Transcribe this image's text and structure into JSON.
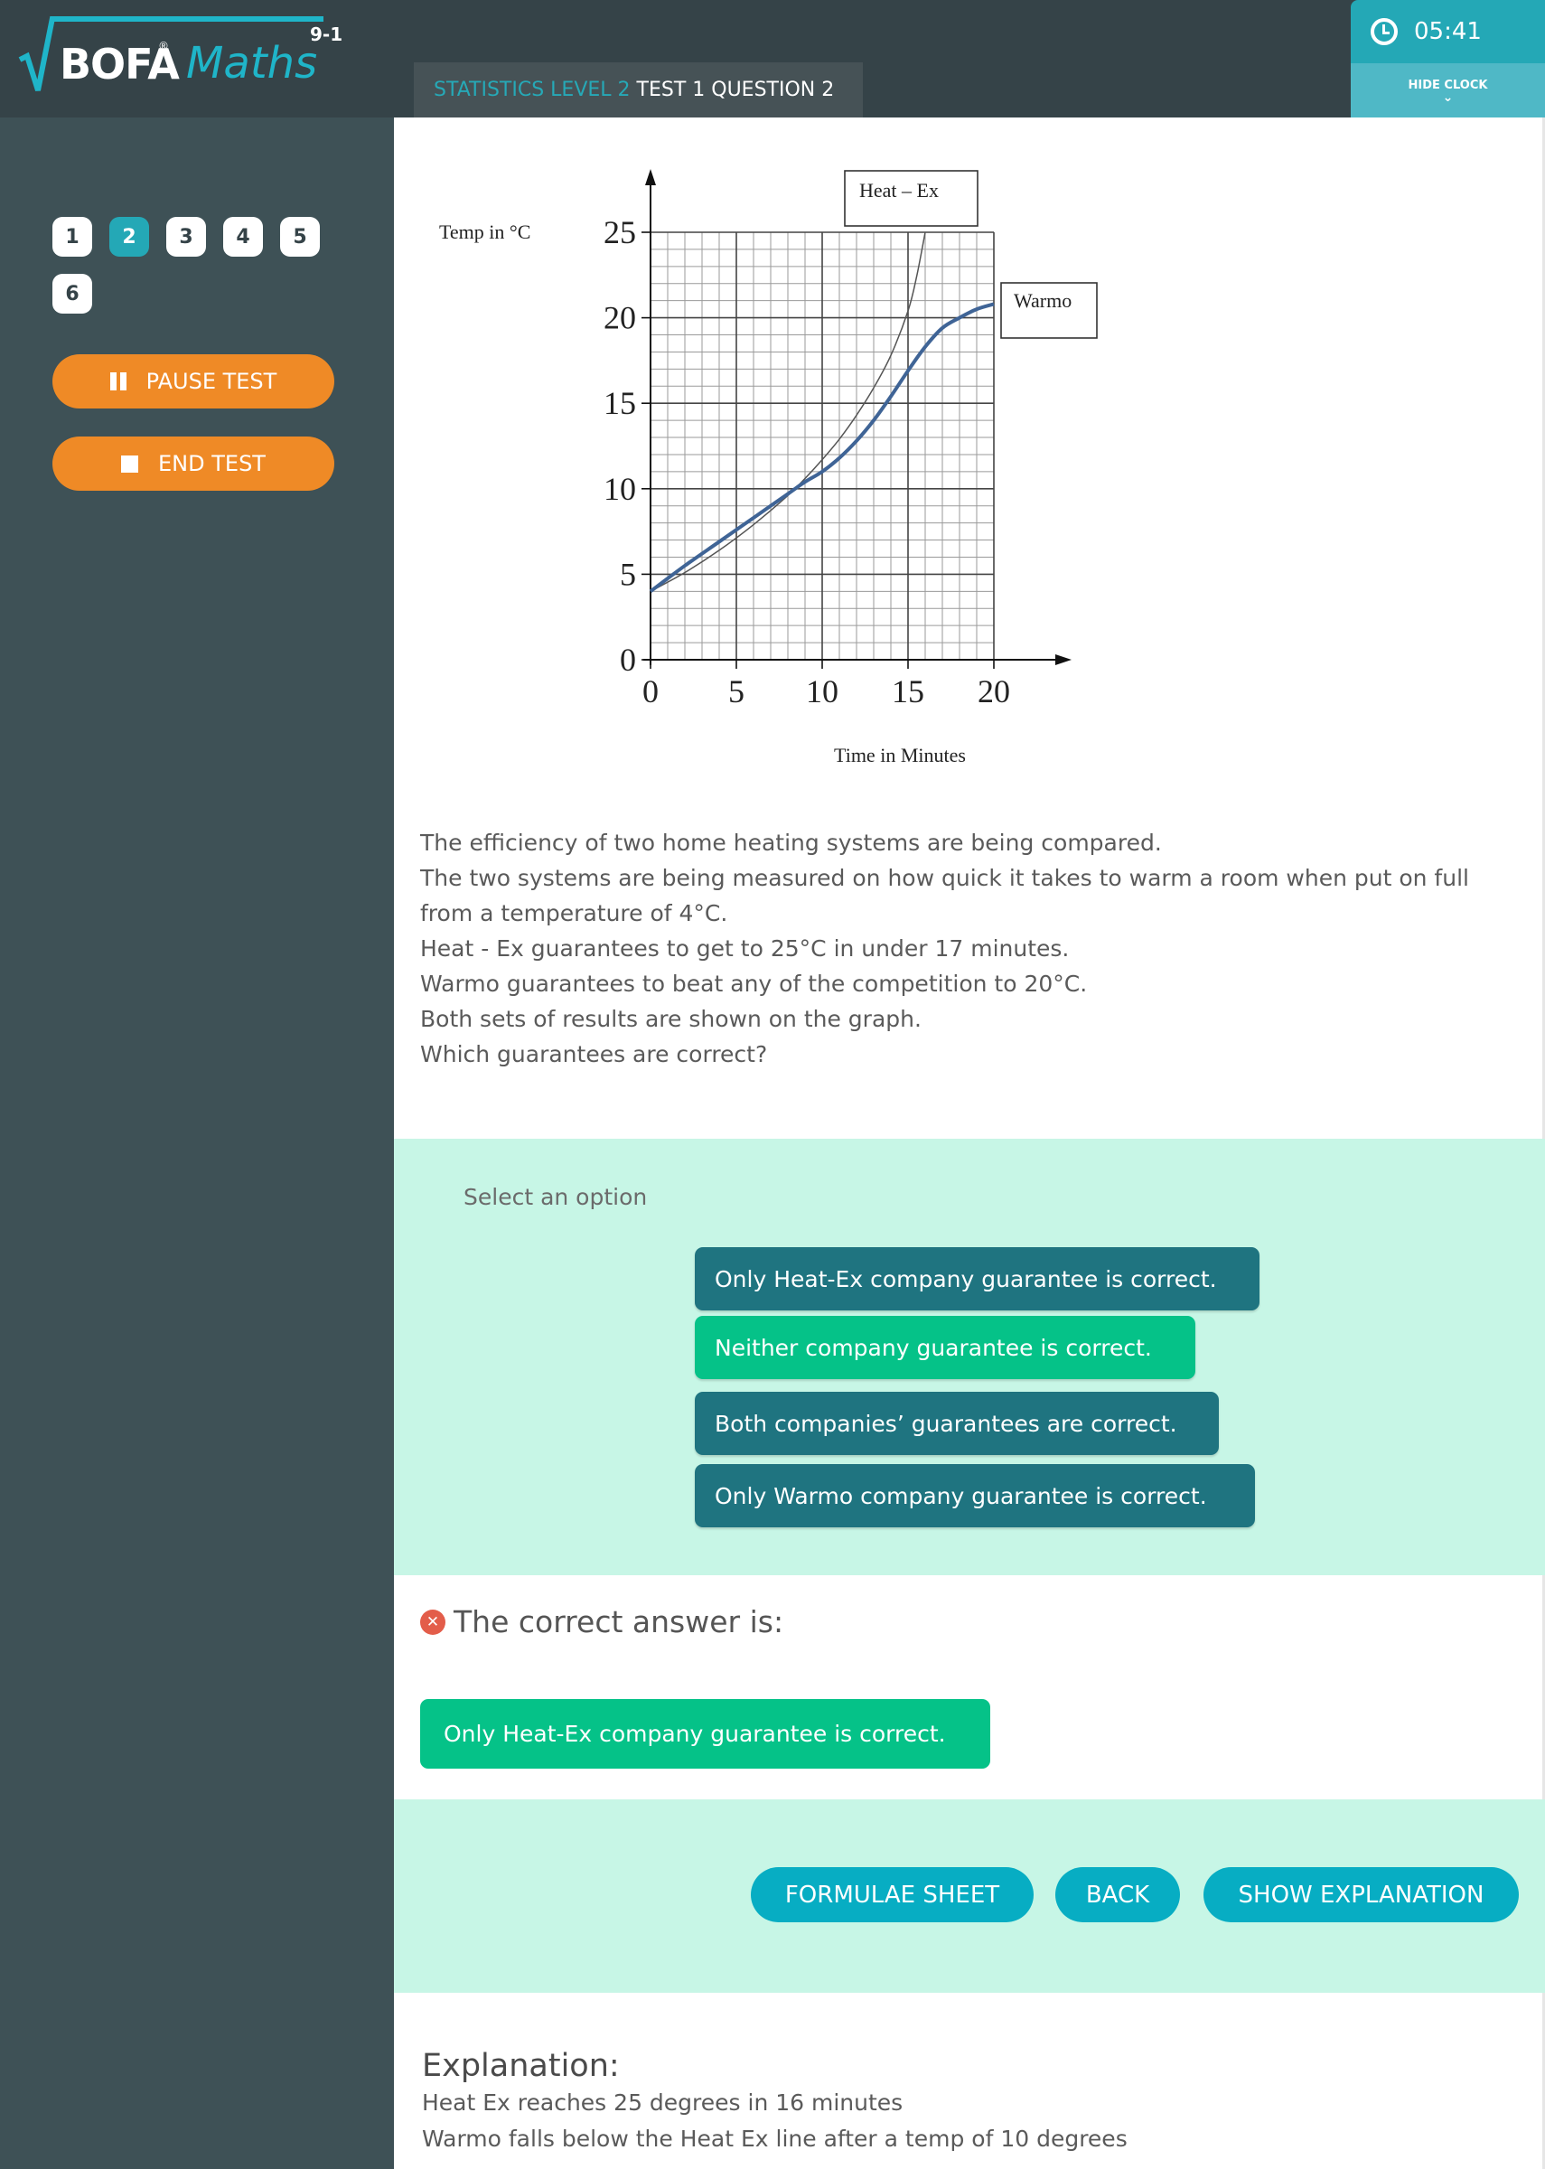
{
  "header": {
    "logo": {
      "brand": "BOFA",
      "registered": "®",
      "product": "Maths",
      "grade": "9-1"
    },
    "title_topic": "STATISTICS LEVEL 2",
    "title_test": "TEST 1 QUESTION 2",
    "clock": {
      "icon": "clock-icon",
      "time": "05:41",
      "hide_label": "HIDE CLOCK",
      "chevron": "chevron-down-icon"
    }
  },
  "sidebar": {
    "questions": [
      {
        "label": "1",
        "active": false
      },
      {
        "label": "2",
        "active": true
      },
      {
        "label": "3",
        "active": false
      },
      {
        "label": "4",
        "active": false
      },
      {
        "label": "5",
        "active": false
      },
      {
        "label": "6",
        "active": false
      }
    ],
    "pause_label": "PAUSE TEST",
    "end_label": "END TEST"
  },
  "question": {
    "lines": [
      "The efficiency of two home heating systems are being compared.",
      "The two systems are being measured on how quick it takes to warm a room when put on full",
      "from a temperature of 4°C.",
      "Heat - Ex guarantees to get to 25°C in under 17 minutes.",
      "Warmo guarantees to beat any of the competition to 20°C.",
      "Both sets of results are shown on the graph.",
      "Which guarantees are correct?"
    ]
  },
  "options": {
    "prompt": "Select an option",
    "items": [
      {
        "label": "Only Heat-Ex company guarantee is correct.",
        "selected": false
      },
      {
        "label": "Neither company guarantee is correct.",
        "selected": true
      },
      {
        "label": "Both companies’ guarantees are correct.",
        "selected": false
      },
      {
        "label": "Only Warmo company guarantee is correct.",
        "selected": false
      }
    ]
  },
  "result": {
    "status_icon": "error-x-icon",
    "heading": "The correct answer is:",
    "correct_answer": "Only Heat-Ex company guarantee is correct."
  },
  "actions": {
    "formulae": "FORMULAE SHEET",
    "back": "BACK",
    "explanation": "SHOW EXPLANATION"
  },
  "explanation": {
    "heading": "Explanation:",
    "lines": [
      "Heat Ex reaches 25 degrees in 16 minutes",
      "Warmo falls below the Heat Ex line after a temp of 10 degrees"
    ]
  },
  "colors": {
    "header_bg": "#354348",
    "sidebar_bg": "#3e5156",
    "accent_teal": "#24a8b6",
    "orange": "#ef8a26",
    "option_bg": "#1f7480",
    "selected_green": "#05c288",
    "panel_mint": "#c7f6e6",
    "action_cyan": "#07adc3",
    "warmo_line": "#3f6496"
  },
  "chart_data": {
    "type": "line",
    "title": "",
    "xlabel": "Time in Minutes",
    "ylabel": "Temp in °C",
    "xlim": [
      0,
      20
    ],
    "ylim": [
      0,
      25
    ],
    "xticks": [
      0,
      5,
      10,
      15,
      20
    ],
    "yticks": [
      0,
      5,
      10,
      15,
      20,
      25
    ],
    "grid": true,
    "minor_grid_step": 1,
    "series": [
      {
        "name": "Heat – Ex",
        "x": [
          0,
          2,
          4,
          6,
          8,
          9,
          10,
          11,
          12,
          13,
          14,
          15,
          15.5,
          16
        ],
        "y": [
          4,
          5.1,
          6.4,
          7.9,
          9.6,
          10.6,
          11.7,
          12.9,
          14.3,
          15.9,
          17.8,
          20.4,
          22.4,
          25
        ]
      },
      {
        "name": "Warmo",
        "x": [
          0,
          2,
          4,
          6,
          8,
          9,
          10,
          11,
          12,
          13,
          14,
          15,
          16,
          17,
          18,
          19,
          20
        ],
        "y": [
          4,
          5.5,
          6.9,
          8.3,
          9.7,
          10.4,
          11.0,
          11.8,
          12.8,
          14.0,
          15.4,
          16.9,
          18.3,
          19.4,
          20.0,
          20.5,
          20.8
        ]
      }
    ],
    "annotations": [
      "Heat – Ex",
      "Warmo"
    ]
  }
}
